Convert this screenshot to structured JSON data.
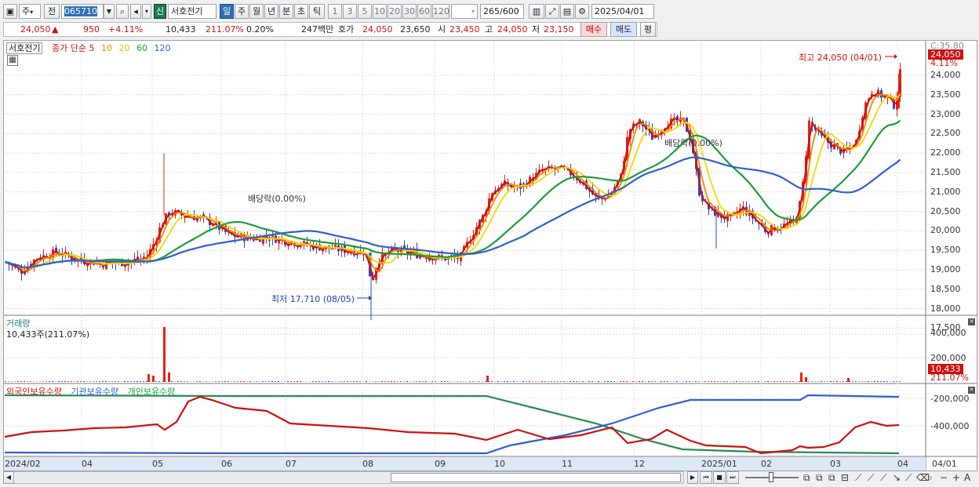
{
  "toolbar": {
    "period_select": "주",
    "prev_label": "전",
    "stock_code": "065710",
    "badge": "신",
    "stock_name": "서호전기",
    "period_tabs": [
      "일",
      "주",
      "월",
      "년",
      "분",
      "초",
      "틱"
    ],
    "interval_buttons": [
      "1",
      "3",
      "5",
      "10",
      "20",
      "30",
      "60",
      "120"
    ],
    "count_value": "265",
    "count_total": "/600",
    "date": "2025/04/01"
  },
  "info": {
    "price": "24,050",
    "change": "950",
    "change_pct": "+4.11%",
    "volume": "10,433",
    "volume_ratio": "211.07%",
    "turnover": "0.20%",
    "amount": "247백만",
    "bid_label": "호가",
    "bid_value": "24,050",
    "open_prev": "23,650",
    "open_label": "시",
    "open_value": "23,450",
    "high_label": "고",
    "high_value": "24,050",
    "low_label": "저",
    "low_value": "23,150",
    "buy_label": "매수",
    "sell_label": "매도",
    "eval_label": "평"
  },
  "price_panel": {
    "name_tag": "서호전기",
    "ma_title": "종가 단순",
    "ma_periods": [
      "5",
      "10",
      "20",
      "60",
      "120"
    ],
    "ma_colors": [
      "#d01010",
      "#f08c00",
      "#f5d800",
      "#1a9e3a",
      "#2f5fd0"
    ],
    "y_ticks": [
      "24,000",
      "23,500",
      "23,000",
      "22,500",
      "22,000",
      "21,500",
      "21,000",
      "20,500",
      "20,000",
      "19,500",
      "19,000",
      "18,500",
      "18,000",
      "17,500"
    ],
    "y_top_label": "C:35.80",
    "current_tag": "24,050",
    "current_pct": "4.11%",
    "max_annotation": "최고 24,050 (04/01)",
    "min_annotation": "최저 17,710 (08/05)",
    "dividend_1": "배당락(0.00%)",
    "dividend_2": "배당락(0.00%)"
  },
  "volume_panel": {
    "title": "거래량",
    "sub": "10,433주(211.07%)",
    "y_ticks": [
      "400,000",
      "200,000"
    ],
    "current_tag": "10,433",
    "current_pct": "211.07%"
  },
  "holding_panel": {
    "legends": [
      "외국인보유수량",
      "기관보유수량",
      "개인보유수량"
    ],
    "legend_colors": [
      "#d01010",
      "#2f5fd0",
      "#1a9e3a"
    ],
    "y_ticks": [
      "-200,000",
      "-400,000"
    ]
  },
  "x_axis": [
    "2024/02",
    "04",
    "05",
    "06",
    "07",
    "08",
    "09",
    "10",
    "11",
    "12",
    "2025/01",
    "02",
    "03",
    "04",
    "04/01"
  ],
  "chart_data": {
    "type": "candlestick",
    "x": [
      "2024/02",
      "04",
      "05",
      "06",
      "07",
      "08",
      "09",
      "10",
      "11",
      "12",
      "2025/01",
      "02",
      "03",
      "04"
    ],
    "close_approx": [
      19100,
      19200,
      20300,
      19900,
      19600,
      19400,
      19300,
      21200,
      20800,
      22900,
      20600,
      20000,
      22100,
      24050
    ],
    "ylim": [
      17500,
      24000
    ],
    "max": {
      "label": "최고 24,050 (04/01)",
      "value": 24050
    },
    "min": {
      "label": "최저 17,710 (08/05)",
      "value": 17710
    }
  }
}
